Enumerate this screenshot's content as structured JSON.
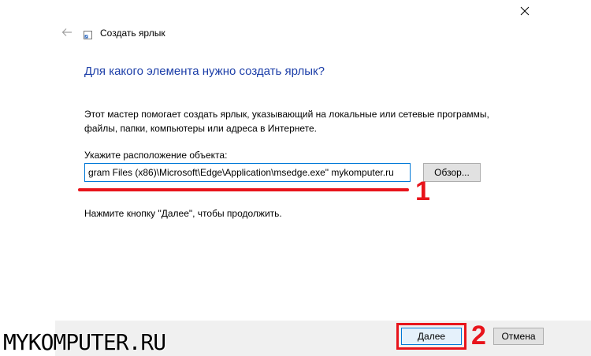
{
  "window": {
    "title": "Создать ярлык",
    "close_icon": "close-icon",
    "back_icon": "back-arrow-icon"
  },
  "main": {
    "heading": "Для какого элемента нужно создать ярлык?",
    "description": "Этот мастер помогает создать ярлык, указывающий на локальные или сетевые программы, файлы, папки, компьютеры или адреса в Интернете.",
    "path_label": "Укажите расположение объекта:",
    "path_value": "gram Files (x86)\\Microsoft\\Edge\\Application\\msedge.exe\" mykomputer.ru",
    "browse_label": "Обзор...",
    "hint": "Нажмите кнопку \"Далее\", чтобы продолжить."
  },
  "footer": {
    "next_label": "Далее",
    "cancel_label": "Отмена"
  },
  "annotations": {
    "marker_1": "1",
    "marker_2": "2",
    "color": "#e8141b"
  },
  "watermark": "MYKOMPUTER.RU",
  "colors": {
    "heading": "#1c3ea8",
    "accent": "#0078d7",
    "footer_bg": "#f0f0f0"
  }
}
